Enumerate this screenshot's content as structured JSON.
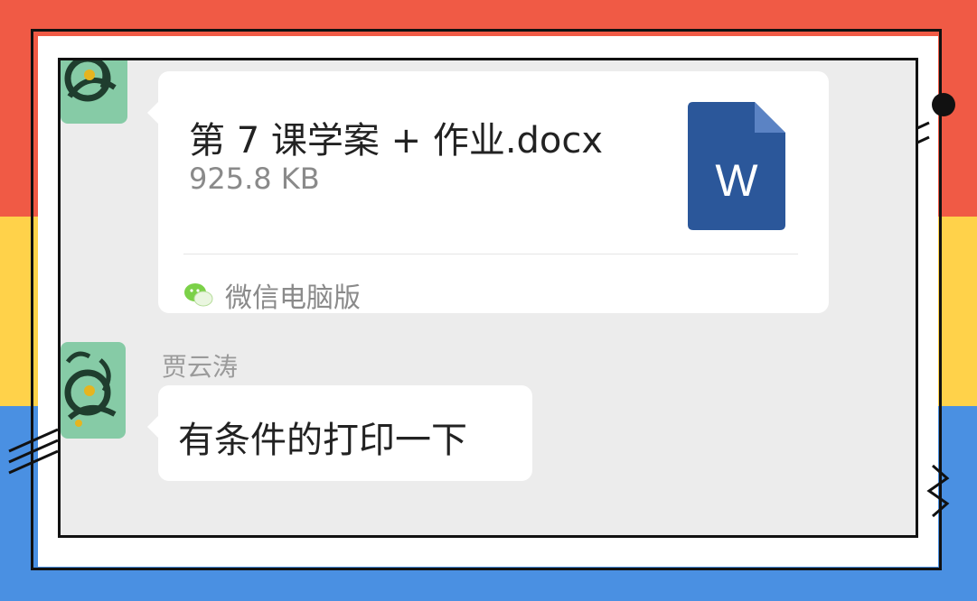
{
  "file_message": {
    "file_name": "第 7 课学案 + 作业.docx",
    "file_size": "925.8 KB",
    "file_type_icon": "word-doc-icon",
    "file_icon_letter": "W",
    "source_label": "微信电脑版",
    "source_icon": "wechat-icon"
  },
  "text_message": {
    "sender_name": "贾云涛",
    "text": "有条件的打印一下"
  },
  "colors": {
    "stripe_red": "#f05a45",
    "stripe_yellow": "#ffd24a",
    "stripe_blue": "#4a90e2",
    "chat_bg": "#ececec",
    "word_blue": "#2b579a",
    "wechat_green": "#7bd148"
  }
}
